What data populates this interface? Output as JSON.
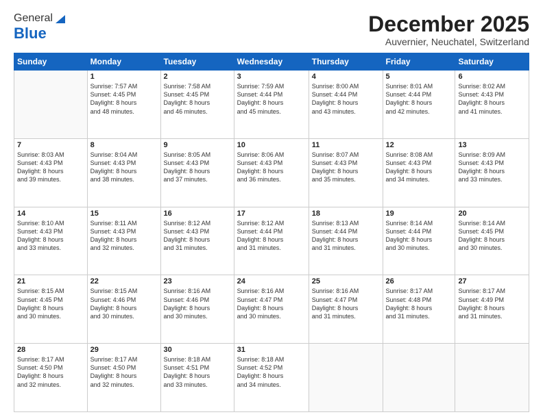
{
  "logo": {
    "general": "General",
    "blue": "Blue"
  },
  "header": {
    "month": "December 2025",
    "location": "Auvernier, Neuchatel, Switzerland"
  },
  "days": [
    "Sunday",
    "Monday",
    "Tuesday",
    "Wednesday",
    "Thursday",
    "Friday",
    "Saturday"
  ],
  "weeks": [
    [
      {
        "day": "",
        "info": ""
      },
      {
        "day": "1",
        "info": "Sunrise: 7:57 AM\nSunset: 4:45 PM\nDaylight: 8 hours\nand 48 minutes."
      },
      {
        "day": "2",
        "info": "Sunrise: 7:58 AM\nSunset: 4:45 PM\nDaylight: 8 hours\nand 46 minutes."
      },
      {
        "day": "3",
        "info": "Sunrise: 7:59 AM\nSunset: 4:44 PM\nDaylight: 8 hours\nand 45 minutes."
      },
      {
        "day": "4",
        "info": "Sunrise: 8:00 AM\nSunset: 4:44 PM\nDaylight: 8 hours\nand 43 minutes."
      },
      {
        "day": "5",
        "info": "Sunrise: 8:01 AM\nSunset: 4:44 PM\nDaylight: 8 hours\nand 42 minutes."
      },
      {
        "day": "6",
        "info": "Sunrise: 8:02 AM\nSunset: 4:43 PM\nDaylight: 8 hours\nand 41 minutes."
      }
    ],
    [
      {
        "day": "7",
        "info": "Sunrise: 8:03 AM\nSunset: 4:43 PM\nDaylight: 8 hours\nand 39 minutes."
      },
      {
        "day": "8",
        "info": "Sunrise: 8:04 AM\nSunset: 4:43 PM\nDaylight: 8 hours\nand 38 minutes."
      },
      {
        "day": "9",
        "info": "Sunrise: 8:05 AM\nSunset: 4:43 PM\nDaylight: 8 hours\nand 37 minutes."
      },
      {
        "day": "10",
        "info": "Sunrise: 8:06 AM\nSunset: 4:43 PM\nDaylight: 8 hours\nand 36 minutes."
      },
      {
        "day": "11",
        "info": "Sunrise: 8:07 AM\nSunset: 4:43 PM\nDaylight: 8 hours\nand 35 minutes."
      },
      {
        "day": "12",
        "info": "Sunrise: 8:08 AM\nSunset: 4:43 PM\nDaylight: 8 hours\nand 34 minutes."
      },
      {
        "day": "13",
        "info": "Sunrise: 8:09 AM\nSunset: 4:43 PM\nDaylight: 8 hours\nand 33 minutes."
      }
    ],
    [
      {
        "day": "14",
        "info": "Sunrise: 8:10 AM\nSunset: 4:43 PM\nDaylight: 8 hours\nand 33 minutes."
      },
      {
        "day": "15",
        "info": "Sunrise: 8:11 AM\nSunset: 4:43 PM\nDaylight: 8 hours\nand 32 minutes."
      },
      {
        "day": "16",
        "info": "Sunrise: 8:12 AM\nSunset: 4:43 PM\nDaylight: 8 hours\nand 31 minutes."
      },
      {
        "day": "17",
        "info": "Sunrise: 8:12 AM\nSunset: 4:44 PM\nDaylight: 8 hours\nand 31 minutes."
      },
      {
        "day": "18",
        "info": "Sunrise: 8:13 AM\nSunset: 4:44 PM\nDaylight: 8 hours\nand 31 minutes."
      },
      {
        "day": "19",
        "info": "Sunrise: 8:14 AM\nSunset: 4:44 PM\nDaylight: 8 hours\nand 30 minutes."
      },
      {
        "day": "20",
        "info": "Sunrise: 8:14 AM\nSunset: 4:45 PM\nDaylight: 8 hours\nand 30 minutes."
      }
    ],
    [
      {
        "day": "21",
        "info": "Sunrise: 8:15 AM\nSunset: 4:45 PM\nDaylight: 8 hours\nand 30 minutes."
      },
      {
        "day": "22",
        "info": "Sunrise: 8:15 AM\nSunset: 4:46 PM\nDaylight: 8 hours\nand 30 minutes."
      },
      {
        "day": "23",
        "info": "Sunrise: 8:16 AM\nSunset: 4:46 PM\nDaylight: 8 hours\nand 30 minutes."
      },
      {
        "day": "24",
        "info": "Sunrise: 8:16 AM\nSunset: 4:47 PM\nDaylight: 8 hours\nand 30 minutes."
      },
      {
        "day": "25",
        "info": "Sunrise: 8:16 AM\nSunset: 4:47 PM\nDaylight: 8 hours\nand 31 minutes."
      },
      {
        "day": "26",
        "info": "Sunrise: 8:17 AM\nSunset: 4:48 PM\nDaylight: 8 hours\nand 31 minutes."
      },
      {
        "day": "27",
        "info": "Sunrise: 8:17 AM\nSunset: 4:49 PM\nDaylight: 8 hours\nand 31 minutes."
      }
    ],
    [
      {
        "day": "28",
        "info": "Sunrise: 8:17 AM\nSunset: 4:50 PM\nDaylight: 8 hours\nand 32 minutes."
      },
      {
        "day": "29",
        "info": "Sunrise: 8:17 AM\nSunset: 4:50 PM\nDaylight: 8 hours\nand 32 minutes."
      },
      {
        "day": "30",
        "info": "Sunrise: 8:18 AM\nSunset: 4:51 PM\nDaylight: 8 hours\nand 33 minutes."
      },
      {
        "day": "31",
        "info": "Sunrise: 8:18 AM\nSunset: 4:52 PM\nDaylight: 8 hours\nand 34 minutes."
      },
      {
        "day": "",
        "info": ""
      },
      {
        "day": "",
        "info": ""
      },
      {
        "day": "",
        "info": ""
      }
    ]
  ]
}
